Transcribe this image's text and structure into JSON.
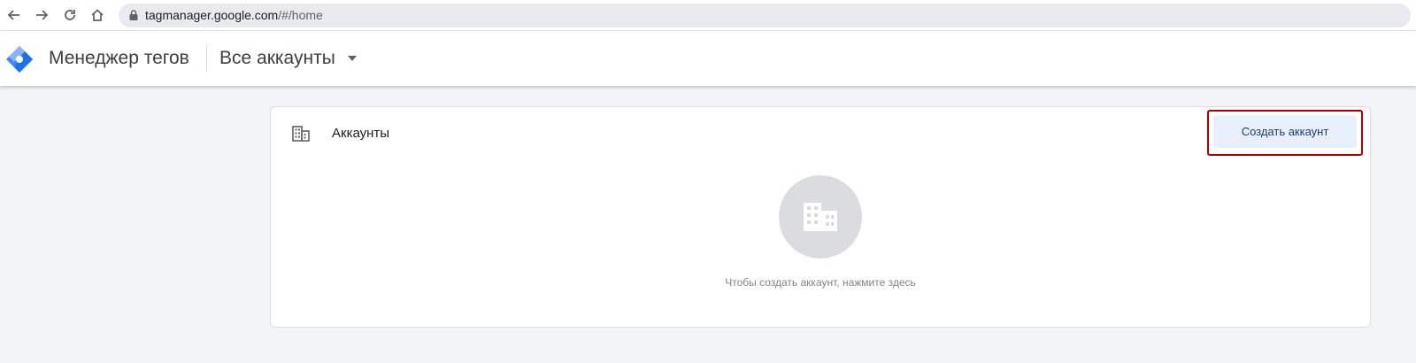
{
  "browser": {
    "url_domain": "tagmanager.google.com",
    "url_path": "/#/home",
    "icons": [
      "back-arrow-icon",
      "forward-arrow-icon",
      "reload-icon",
      "home-icon",
      "lock-icon"
    ]
  },
  "header": {
    "product_name": "Менеджер тегов",
    "account_selector": "Все аккаунты",
    "icons": [
      "tag-manager-logo",
      "dropdown-arrow-icon"
    ]
  },
  "accounts_card": {
    "title": "Аккаунты",
    "create_button": "Создать аккаунт",
    "empty_message": "Чтобы создать аккаунт, нажмите здесь",
    "icons": [
      "building-icon",
      "building-large-icon"
    ]
  },
  "colors": {
    "highlight_border": "#b00000",
    "button_bg": "#e8f0fe",
    "button_text": "#1a3c78",
    "logo_blue": "#4285f4",
    "logo_dark_blue": "#1a73e8",
    "page_bg": "#f1f3f4"
  }
}
